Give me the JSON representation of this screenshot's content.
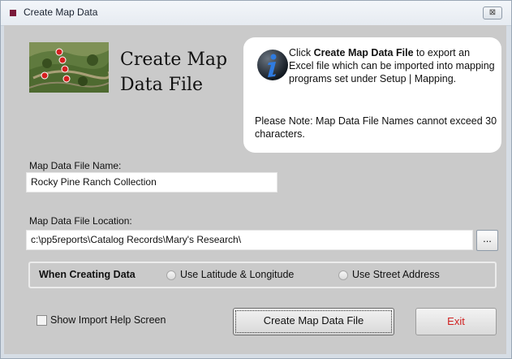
{
  "window": {
    "title": "Create Map Data",
    "close_symbol": "⊠"
  },
  "header": {
    "line1": "Create Map",
    "line2": "Data File"
  },
  "info": {
    "text_prefix": "Click ",
    "text_bold": "Create Map Data File",
    "text_suffix": " to export an Excel file which can be imported into mapping programs set under Setup | Mapping.",
    "note": "Please Note: Map Data File Names cannot exceed 30 characters."
  },
  "form": {
    "name_label": "Map Data File Name:",
    "name_value": "Rocky Pine Ranch Collection",
    "location_label": "Map Data File Location:",
    "location_value": "c:\\pp5reports\\Catalog Records\\Mary's Research\\",
    "browse_label": "..."
  },
  "options": {
    "group_label": "When Creating Data",
    "radio1": "Use Latitude & Longitude",
    "radio2": "Use Street Address"
  },
  "footer": {
    "checkbox_label": "Show Import Help Screen",
    "create_button": "Create Map Data File",
    "exit_button": "Exit"
  },
  "colors": {
    "exit_text": "#d02020",
    "info_bg": "#ffffff",
    "panel_bg": "#cacaca",
    "accent_blue": "#1f5fa8"
  }
}
